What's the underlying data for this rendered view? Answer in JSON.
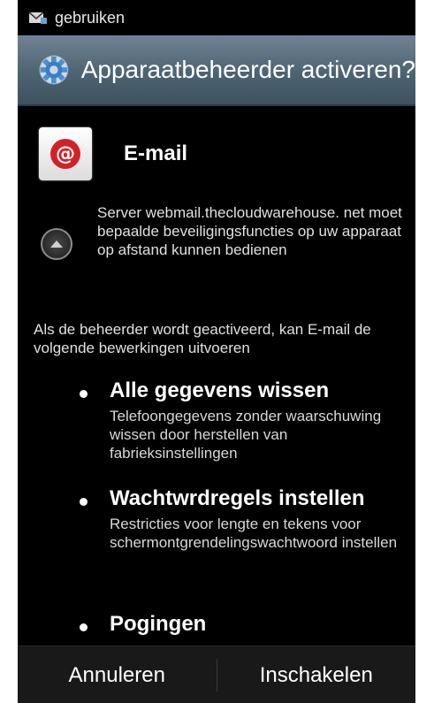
{
  "status_bar": {
    "text": "gebruiken",
    "icon": "mail-icon"
  },
  "header": {
    "title": "Apparaatbeheerder activeren?",
    "icon": "gear-icon"
  },
  "app": {
    "name": "E-mail",
    "icon_glyph": "@",
    "icon": "email-app-icon"
  },
  "server": {
    "text": "Server webmail.thecloudwarehouse. net moet bepaalde beveiligingsfuncties op uw apparaat op afstand kunnen bedienen"
  },
  "intro": {
    "text": "Als de beheerder wordt geactiveerd, kan E-mail de volgende bewerkingen uitvoeren"
  },
  "policies": [
    {
      "title": "Alle gegevens wissen",
      "description": "Telefoongegevens zonder waarschuwing wissen door herstellen van fabrieksinstellingen"
    },
    {
      "title": "Wachtwrdregels instellen",
      "description": "Restricties voor lengte en tekens voor schermontgrendelingswachtwoord instellen"
    },
    {
      "title": "Pogingen",
      "description": ""
    }
  ],
  "buttons": {
    "cancel": "Annuleren",
    "enable": "Inschakelen"
  },
  "colors": {
    "background": "#000000",
    "title_bar": "#4e6372",
    "accent_red": "#d42128",
    "button_bar": "#191919"
  }
}
